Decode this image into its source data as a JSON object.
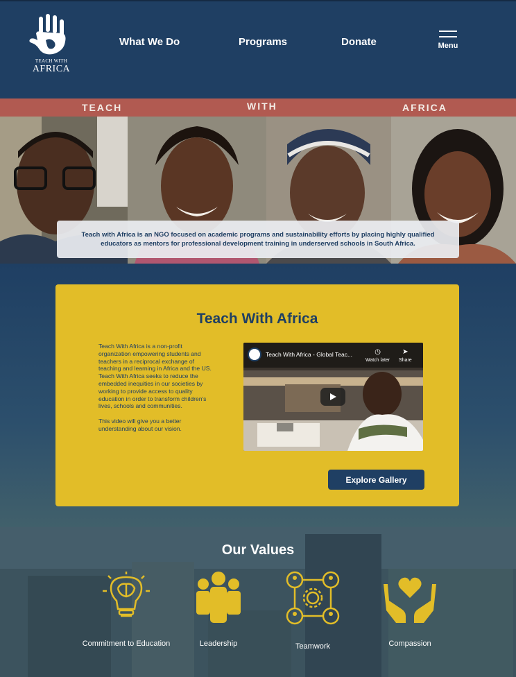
{
  "header": {
    "logo_line1": "TEACH WITH",
    "logo_line2": "AFRICA",
    "nav": [
      "What We Do",
      "Programs",
      "Donate"
    ],
    "menu_label": "Menu"
  },
  "hero": {
    "band": [
      "TEACH",
      "WITH",
      "AFRICA"
    ],
    "caption": "Teach with Africa is an NGO focused on academic programs and sustainability efforts by placing highly qualified educators as mentors for professional development training in underserved schools in South Africa."
  },
  "about": {
    "title": "Teach With Africa",
    "paragraph1": "Teach With Africa is a non-profit organization empowering students and teachers in a reciprocal exchange of teaching and learning in Africa and the US. Teach With Africa seeks to reduce the embedded inequities in our societies by working to provide access to quality education in order to transform children's lives, schools and communities.",
    "paragraph2": "This video will give you a better understanding about our vision.",
    "video": {
      "title": "Teach With Africa - Global Teac...",
      "watch_later": "Watch later",
      "share": "Share"
    },
    "gallery_button": "Explore Gallery"
  },
  "values": {
    "title": "Our Values",
    "items": [
      {
        "label": "Commitment to Education",
        "icon": "lightbulb-brain-icon"
      },
      {
        "label": "Leadership",
        "icon": "people-group-icon"
      },
      {
        "label": "Teamwork",
        "icon": "network-gear-icon"
      },
      {
        "label": "Compassion",
        "icon": "hands-heart-icon"
      }
    ],
    "icon_color": "#e2bd28"
  },
  "colors": {
    "navy": "#1f3f63",
    "gold": "#e2bd28",
    "band": "#b15a51"
  }
}
